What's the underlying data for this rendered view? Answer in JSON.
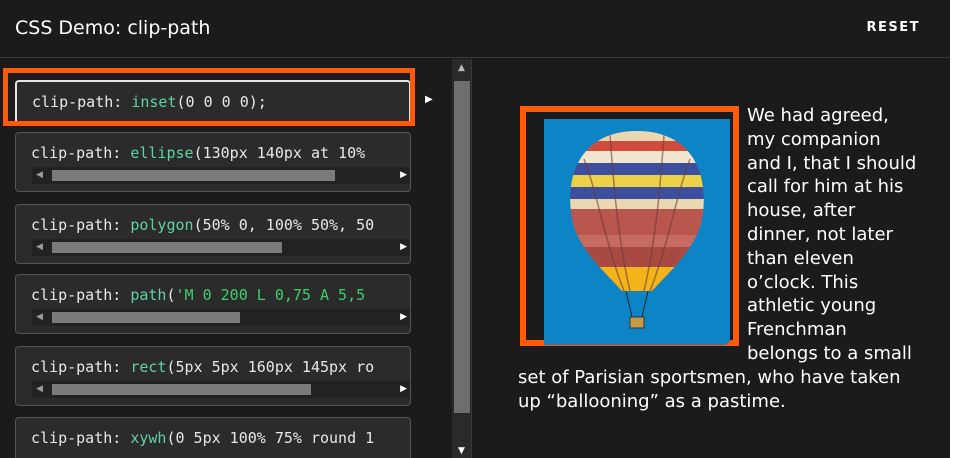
{
  "header": {
    "title": "CSS Demo: clip-path",
    "reset_label": "RESET"
  },
  "choices": [
    {
      "prop": "clip-path:",
      "fn": "inset",
      "args": "(0 0 0 0);",
      "selected": true
    },
    {
      "prop": "clip-path:",
      "fn": "ellipse",
      "args": "(130px 140px at 10%"
    },
    {
      "prop": "clip-path:",
      "fn": "polygon",
      "args": "(50% 0, 100% 50%, 50"
    },
    {
      "prop": "clip-path:",
      "fn": "path",
      "args": "(",
      "str": "'M 0 200 L 0,75 A 5,5"
    },
    {
      "prop": "clip-path:",
      "fn": "rect",
      "args": "(5px 5px 160px 145px ro"
    },
    {
      "prop": "clip-path:",
      "fn": "xywh",
      "args": "(0 5px 100% 75% round 1"
    }
  ],
  "output": {
    "paragraph": "We had agreed, my companion and I, that I should call for him at his house, after dinner, not later than eleven o’clock. This athletic young Frenchman belongs to a small set of Parisian sportsmen, who have taken up “ballooning” as a pastime."
  },
  "colors": {
    "accent": "#ff5a0a",
    "function": "#5fd3a0",
    "string": "#3fcf6a",
    "sky": "#0d84c6"
  },
  "icons": [
    "play-arrow-icon",
    "scroll-left-arrow-icon",
    "scroll-right-arrow-icon",
    "scroll-up-arrow-icon",
    "scroll-down-arrow-icon",
    "hot-air-balloon-image"
  ]
}
